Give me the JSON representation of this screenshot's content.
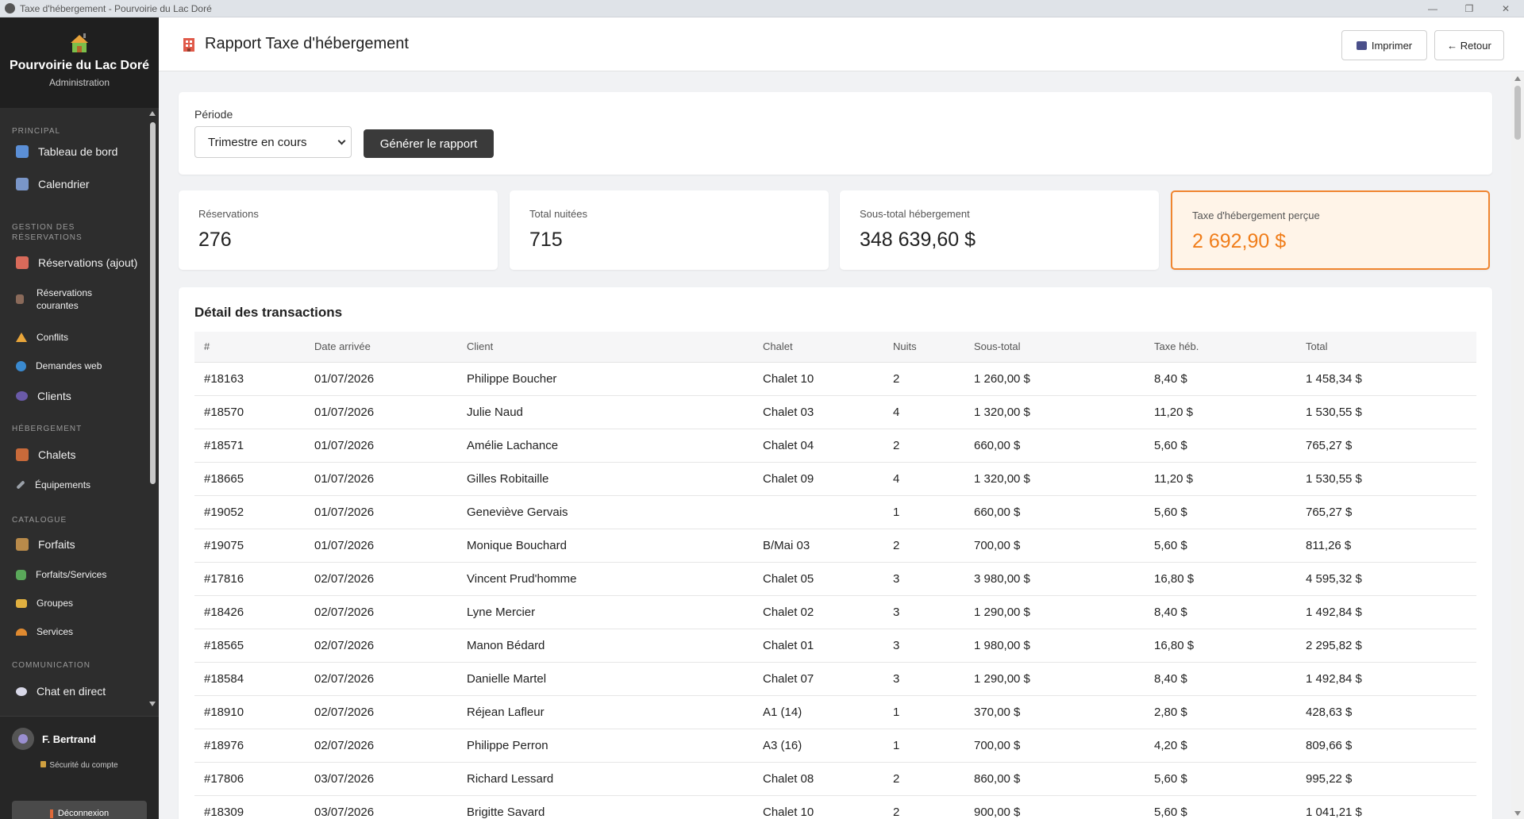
{
  "window": {
    "title": "Taxe d'hébergement - Pourvoirie du Lac Doré"
  },
  "brand": {
    "name": "Pourvoirie du Lac Doré",
    "subtitle": "Administration"
  },
  "nav": {
    "sections": {
      "principal": "PRINCIPAL",
      "gestion": "GESTION DES RÉSERVATIONS",
      "hebergement": "HÉBERGEMENT",
      "catalogue": "CATALOGUE",
      "communication": "COMMUNICATION"
    },
    "items": {
      "dashboard": "Tableau de bord",
      "calendar": "Calendrier",
      "reservations_add": "Réservations (ajout)",
      "reservations_current": "Réservations courantes",
      "conflicts": "Conflits",
      "web_requests": "Demandes web",
      "clients": "Clients",
      "chalets": "Chalets",
      "equipment": "Équipements",
      "packages": "Forfaits",
      "packages_services": "Forfaits/Services",
      "groups": "Groupes",
      "services": "Services",
      "chat": "Chat en direct"
    }
  },
  "user": {
    "name": "F. Bertrand",
    "security": "Sécurité du compte",
    "logout": "Déconnexion"
  },
  "header": {
    "title": "Rapport Taxe d'hébergement",
    "print": "Imprimer",
    "back": "← Retour"
  },
  "filter": {
    "label": "Période",
    "selected": "Trimestre en cours",
    "generate": "Générer le rapport"
  },
  "stats": {
    "reservations": {
      "label": "Réservations",
      "value": "276"
    },
    "nights": {
      "label": "Total nuitées",
      "value": "715"
    },
    "subtotal": {
      "label": "Sous-total hébergement",
      "value": "348 639,60 $"
    },
    "tax": {
      "label": "Taxe d'hébergement perçue",
      "value": "2 692,90 $"
    }
  },
  "colors": {
    "accent": "#f07d1a",
    "sidebar": "#2d2d2d",
    "button_dark": "#3a3a3a"
  },
  "table": {
    "title": "Détail des transactions",
    "headers": [
      "#",
      "Date arrivée",
      "Client",
      "Chalet",
      "Nuits",
      "Sous-total",
      "Taxe héb.",
      "Total"
    ],
    "rows": [
      [
        "#18163",
        "01/07/2026",
        "Philippe Boucher",
        "Chalet 10",
        "2",
        "1 260,00 $",
        "8,40 $",
        "1 458,34 $"
      ],
      [
        "#18570",
        "01/07/2026",
        "Julie Naud",
        "Chalet 03",
        "4",
        "1 320,00 $",
        "11,20 $",
        "1 530,55 $"
      ],
      [
        "#18571",
        "01/07/2026",
        "Amélie Lachance",
        "Chalet 04",
        "2",
        "660,00 $",
        "5,60 $",
        "765,27 $"
      ],
      [
        "#18665",
        "01/07/2026",
        "Gilles Robitaille",
        "Chalet 09",
        "4",
        "1 320,00 $",
        "11,20 $",
        "1 530,55 $"
      ],
      [
        "#19052",
        "01/07/2026",
        "Geneviève Gervais",
        "",
        "1",
        "660,00 $",
        "5,60 $",
        "765,27 $"
      ],
      [
        "#19075",
        "01/07/2026",
        "Monique Bouchard",
        "B/Mai 03",
        "2",
        "700,00 $",
        "5,60 $",
        "811,26 $"
      ],
      [
        "#17816",
        "02/07/2026",
        "Vincent Prud'homme",
        "Chalet 05",
        "3",
        "3 980,00 $",
        "16,80 $",
        "4 595,32 $"
      ],
      [
        "#18426",
        "02/07/2026",
        "Lyne Mercier",
        "Chalet 02",
        "3",
        "1 290,00 $",
        "8,40 $",
        "1 492,84 $"
      ],
      [
        "#18565",
        "02/07/2026",
        "Manon Bédard",
        "Chalet 01",
        "3",
        "1 980,00 $",
        "16,80 $",
        "2 295,82 $"
      ],
      [
        "#18584",
        "02/07/2026",
        "Danielle Martel",
        "Chalet 07",
        "3",
        "1 290,00 $",
        "8,40 $",
        "1 492,84 $"
      ],
      [
        "#18910",
        "02/07/2026",
        "Réjean Lafleur",
        "A1 (14)",
        "1",
        "370,00 $",
        "2,80 $",
        "428,63 $"
      ],
      [
        "#18976",
        "02/07/2026",
        "Philippe Perron",
        "A3 (16)",
        "1",
        "700,00 $",
        "4,20 $",
        "809,66 $"
      ],
      [
        "#17806",
        "03/07/2026",
        "Richard Lessard",
        "Chalet 08",
        "2",
        "860,00 $",
        "5,60 $",
        "995,22 $"
      ],
      [
        "#18309",
        "03/07/2026",
        "Brigitte Savard",
        "Chalet 10",
        "2",
        "900,00 $",
        "5,60 $",
        "1 041,21 $"
      ]
    ]
  }
}
